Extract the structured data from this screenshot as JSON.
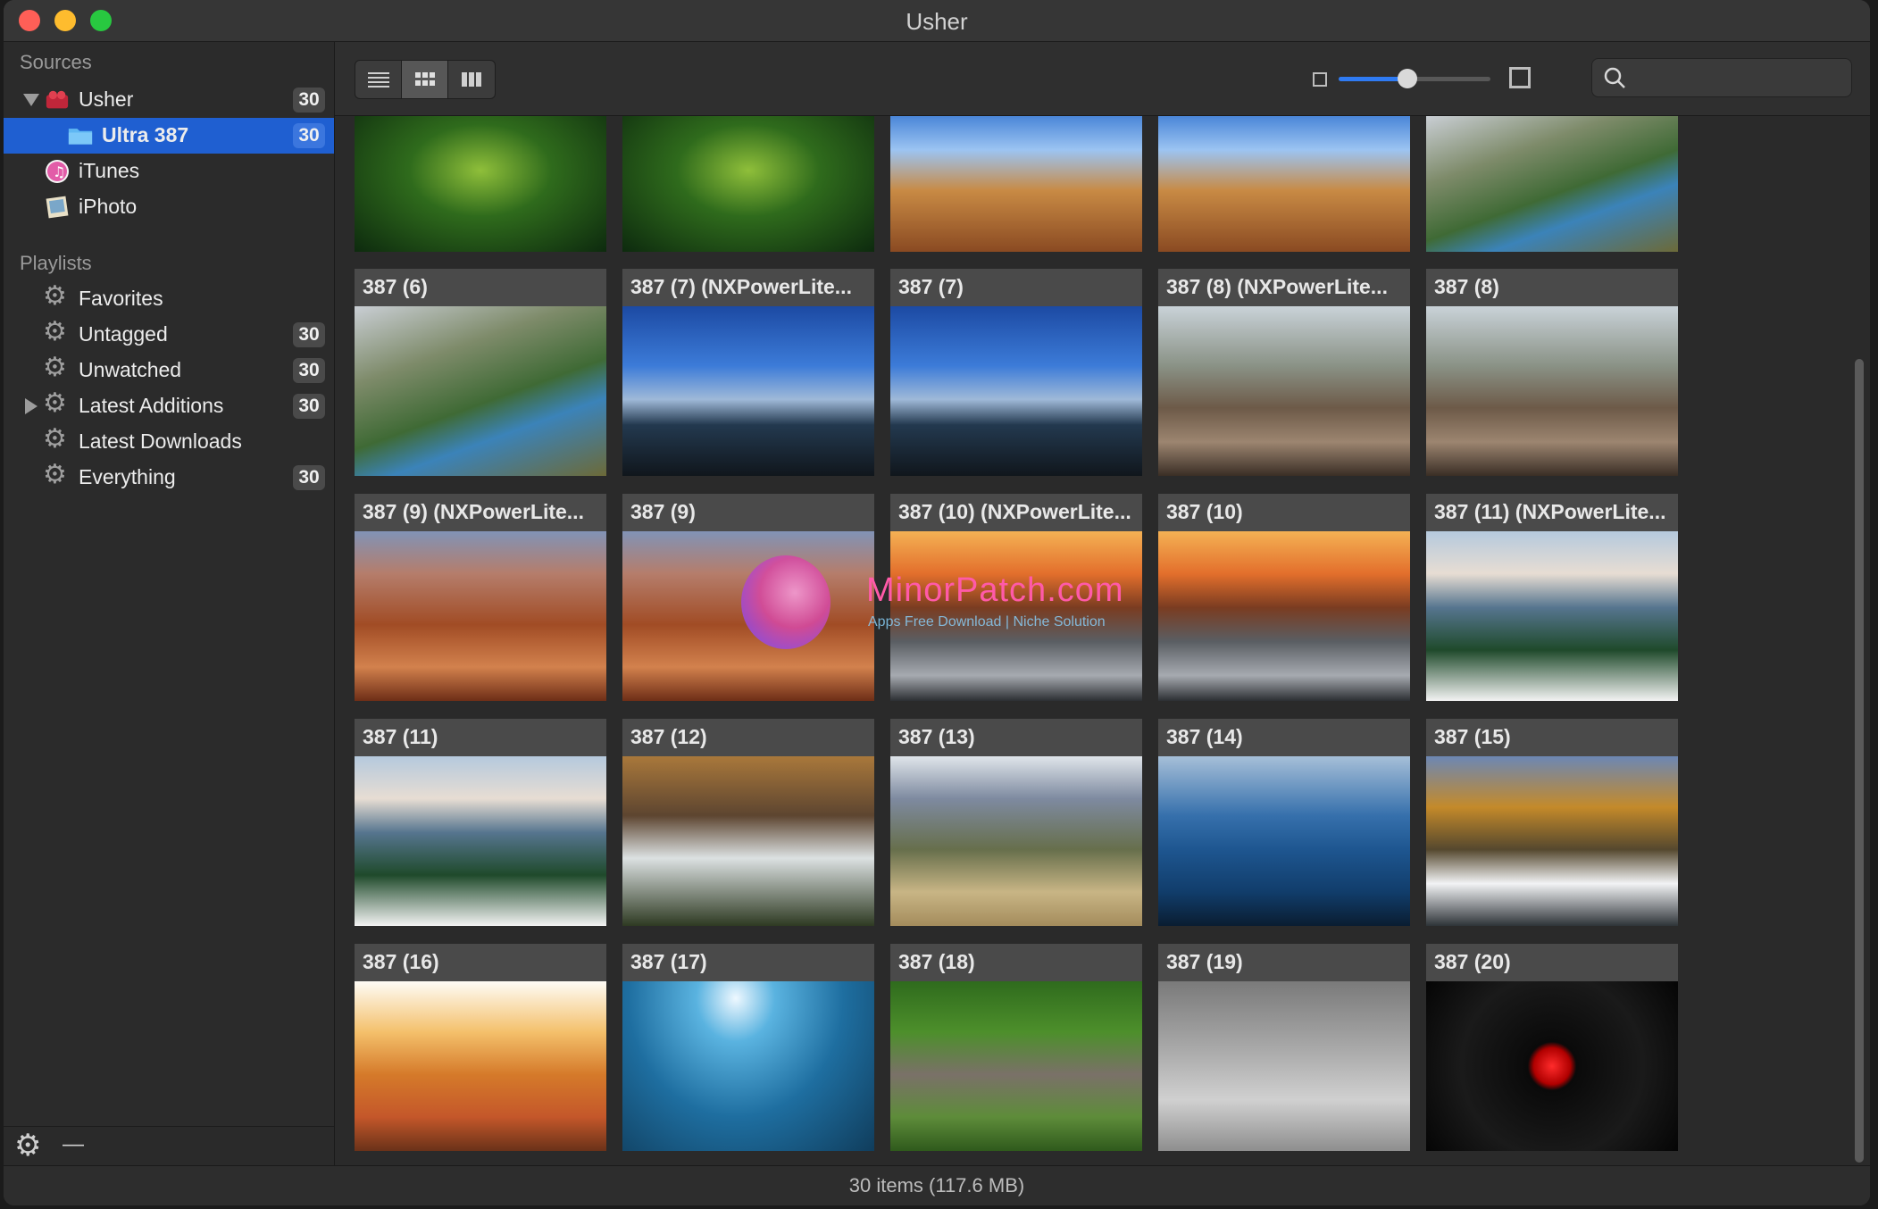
{
  "window": {
    "title": "Usher"
  },
  "sidebar": {
    "sources_header": "Sources",
    "playlists_header": "Playlists",
    "sources": [
      {
        "label": "Usher",
        "count": "30",
        "icon": "usher-icon"
      },
      {
        "label": "Ultra 387",
        "count": "30",
        "icon": "folder-icon",
        "selected": true
      },
      {
        "label": "iTunes",
        "count": "",
        "icon": "itunes-icon"
      },
      {
        "label": "iPhoto",
        "count": "",
        "icon": "iphoto-icon"
      }
    ],
    "playlists": [
      {
        "label": "Favorites",
        "count": ""
      },
      {
        "label": "Untagged",
        "count": "30"
      },
      {
        "label": "Unwatched",
        "count": "30"
      },
      {
        "label": "Latest Additions",
        "count": "30"
      },
      {
        "label": "Latest Downloads",
        "count": ""
      },
      {
        "label": "Everything",
        "count": "30"
      }
    ],
    "bottom_remove": "—"
  },
  "toolbar": {
    "view_modes": [
      "list-view-icon",
      "grid-view-icon",
      "column-view-icon"
    ],
    "active_view": "grid",
    "zoom_level": 0.45,
    "search_placeholder": ""
  },
  "grid": {
    "partial_row": [
      {
        "caption": "",
        "image": "grasshopper"
      },
      {
        "caption": "",
        "image": "grasshopper"
      },
      {
        "caption": "",
        "image": "canyon-tree"
      },
      {
        "caption": "",
        "image": "canyon-tree"
      },
      {
        "caption": "",
        "image": "yellowstone"
      }
    ],
    "items": [
      {
        "caption": "387 (6)",
        "image": "yellowstone"
      },
      {
        "caption": "387 (7) (NXPowerLite...",
        "image": "storm"
      },
      {
        "caption": "387 (7)",
        "image": "storm"
      },
      {
        "caption": "387 (8) (NXPowerLite...",
        "image": "cypress"
      },
      {
        "caption": "387 (8)",
        "image": "cypress"
      },
      {
        "caption": "387 (9) (NXPowerLite...",
        "image": "bryce"
      },
      {
        "caption": "387 (9)",
        "image": "bryce"
      },
      {
        "caption": "387 (10) (NXPowerLite...",
        "image": "halfdome"
      },
      {
        "caption": "387 (10)",
        "image": "halfdome"
      },
      {
        "caption": "387 (11) (NXPowerLite...",
        "image": "snowpine"
      },
      {
        "caption": "387 (11)",
        "image": "snowpine"
      },
      {
        "caption": "387 (12)",
        "image": "forestfalls"
      },
      {
        "caption": "387 (13)",
        "image": "valley"
      },
      {
        "caption": "387 (14)",
        "image": "lake"
      },
      {
        "caption": "387 (15)",
        "image": "winterstream"
      },
      {
        "caption": "387 (16)",
        "image": "spa"
      },
      {
        "caption": "387 (17)",
        "image": "underwater"
      },
      {
        "caption": "387 (18)",
        "image": "elephant"
      },
      {
        "caption": "387 (19)",
        "image": "bulbs"
      },
      {
        "caption": "387 (20)",
        "image": "cherry"
      }
    ]
  },
  "watermark": {
    "title": "MinorPatch.com",
    "subtitle": "Apps Free Download | Niche Solution"
  },
  "status": {
    "text": "30 items (117.6 MB)"
  }
}
